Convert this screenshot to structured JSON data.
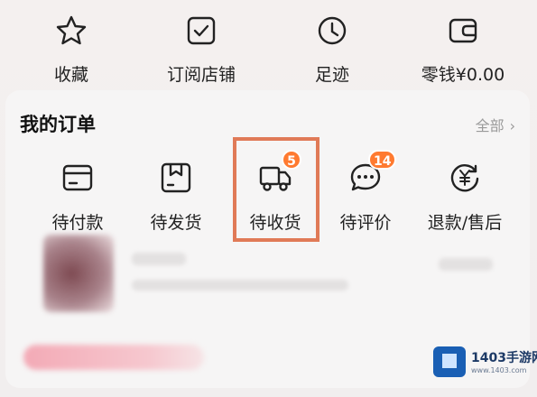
{
  "quick": {
    "items": [
      {
        "label": "收藏",
        "icon": "star-icon"
      },
      {
        "label": "订阅店铺",
        "icon": "checkbox-icon"
      },
      {
        "label": "足迹",
        "icon": "clock-icon"
      },
      {
        "label": "零钱¥0.00",
        "icon": "wallet-icon"
      }
    ]
  },
  "orders": {
    "title": "我的订单",
    "all_label": "全部",
    "items": [
      {
        "label": "待付款",
        "icon": "card-icon",
        "badge": ""
      },
      {
        "label": "待发货",
        "icon": "box-icon",
        "badge": ""
      },
      {
        "label": "待收货",
        "icon": "truck-icon",
        "badge": "5"
      },
      {
        "label": "待评价",
        "icon": "chat-icon",
        "badge": "14"
      },
      {
        "label": "退款/售后",
        "icon": "refund-icon",
        "badge": ""
      }
    ]
  },
  "watermark": {
    "name": "1403手游网",
    "url": "www.1403.com"
  },
  "colors": {
    "badge": "#ff7a30",
    "highlight": "#e07a57",
    "icon_stroke": "#222222"
  }
}
